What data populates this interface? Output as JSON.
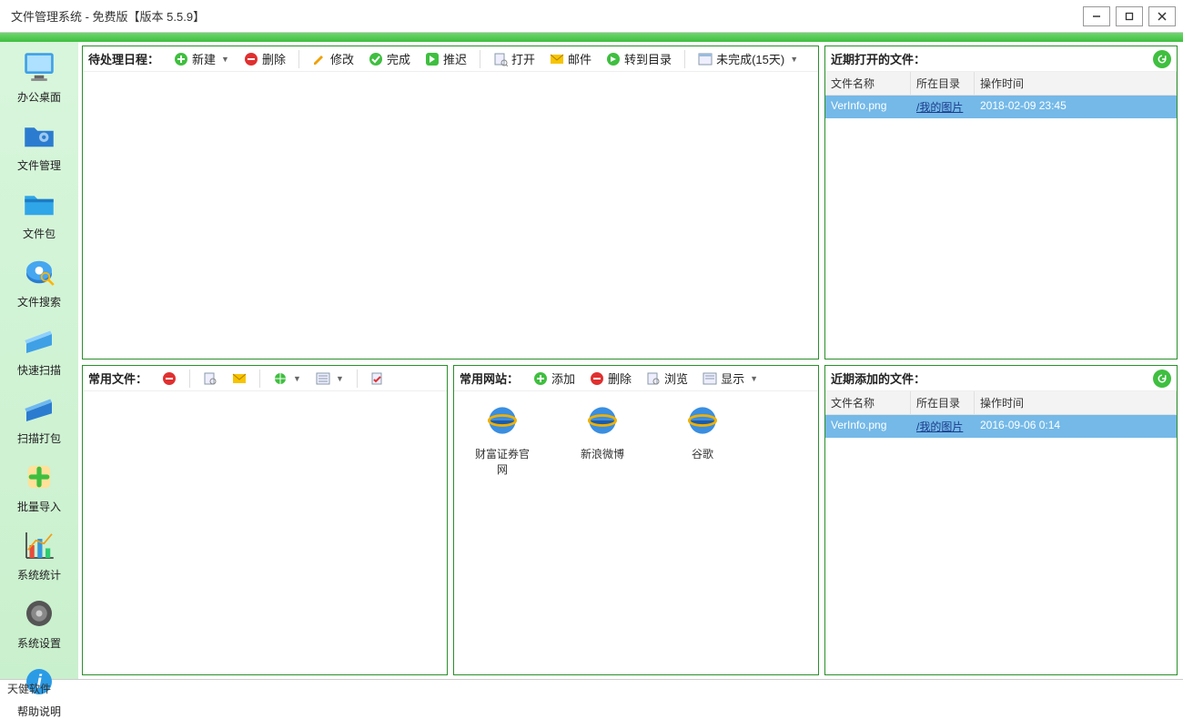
{
  "title": "文件管理系统 - 免费版【版本 5.5.9】",
  "sidebar": [
    {
      "label": "办公桌面"
    },
    {
      "label": "文件管理"
    },
    {
      "label": "文件包"
    },
    {
      "label": "文件搜索"
    },
    {
      "label": "快速扫描"
    },
    {
      "label": "扫描打包"
    },
    {
      "label": "批量导入"
    },
    {
      "label": "系统统计"
    },
    {
      "label": "系统设置"
    },
    {
      "label": "帮助说明"
    }
  ],
  "schedule": {
    "title": "待处理日程：",
    "new": "新建",
    "delete": "删除",
    "edit": "修改",
    "complete": "完成",
    "delay": "推迟",
    "open": "打开",
    "mail": "邮件",
    "moveto": "转到目录",
    "incomplete": "未完成(15天)"
  },
  "recent_open": {
    "title": "近期打开的文件：",
    "cols": {
      "name": "文件名称",
      "dir": "所在目录",
      "time": "操作时间"
    },
    "rows": [
      {
        "name": "VerInfo.png",
        "dir": "/我的图片",
        "time": "2018-02-09 23:45"
      }
    ]
  },
  "common_files": {
    "title": "常用文件："
  },
  "common_sites": {
    "title": "常用网站：",
    "add": "添加",
    "delete": "删除",
    "browse": "浏览",
    "show": "显示",
    "items": [
      {
        "label": "财富证券官网"
      },
      {
        "label": "新浪微博"
      },
      {
        "label": "谷歌"
      }
    ]
  },
  "recent_add": {
    "title": "近期添加的文件：",
    "cols": {
      "name": "文件名称",
      "dir": "所在目录",
      "time": "操作时间"
    },
    "rows": [
      {
        "name": "VerInfo.png",
        "dir": "/我的图片",
        "time": "2016-09-06 0:14"
      }
    ]
  },
  "status": "天健软件"
}
